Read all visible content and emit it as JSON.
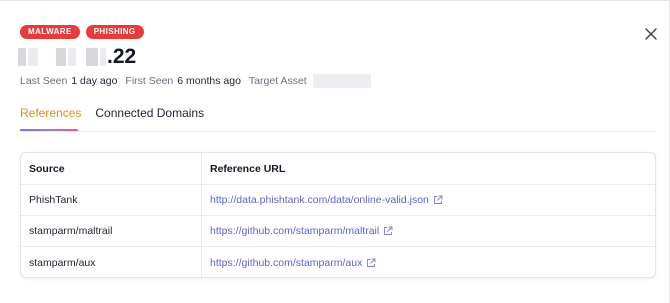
{
  "badges": [
    "MALWARE",
    "PHISHING"
  ],
  "title": {
    "suffix": ".22"
  },
  "meta": {
    "last_seen_label": "Last Seen",
    "last_seen_value": "1 day ago",
    "first_seen_label": "First Seen",
    "first_seen_value": "6 months ago",
    "target_asset_label": "Target Asset"
  },
  "tabs": [
    {
      "label": "References",
      "active": true
    },
    {
      "label": "Connected Domains",
      "active": false
    }
  ],
  "table": {
    "headers": {
      "source": "Source",
      "url": "Reference URL"
    },
    "rows": [
      {
        "source": "PhishTank",
        "url": "http://data.phishtank.com/data/online-valid.json"
      },
      {
        "source": "stamparm/maltrail",
        "url": "https://github.com/stamparm/maltrail"
      },
      {
        "source": "stamparm/aux",
        "url": "https://github.com/stamparm/aux"
      }
    ]
  },
  "colors": {
    "badge": "#e53b3b",
    "active_tab": "#d9901a",
    "link": "#5b63c9"
  },
  "icons": {
    "close": "close-icon",
    "external": "external-link-icon"
  }
}
